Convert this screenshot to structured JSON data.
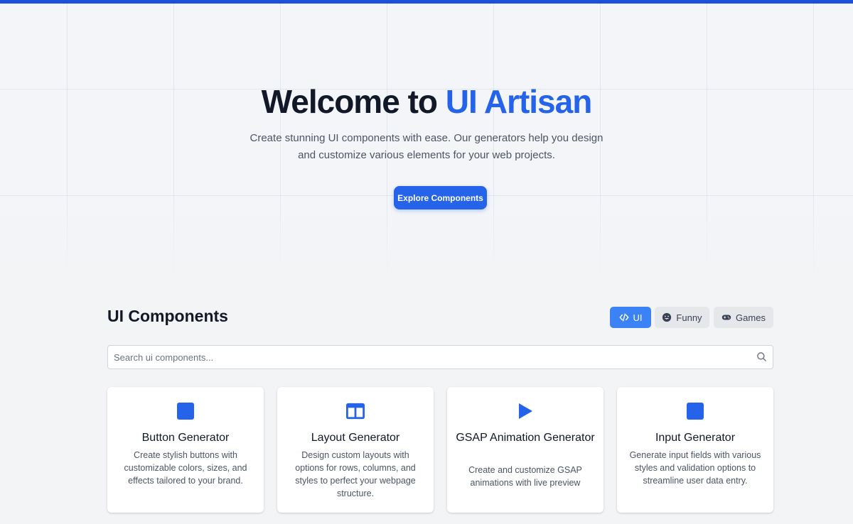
{
  "hero": {
    "title_main": "Welcome to ",
    "title_accent": "UI Artisan",
    "subtitle": "Create stunning UI components with ease. Our generators help you design and customize various elements for your web projects.",
    "cta_label": "Explore Components"
  },
  "section": {
    "title": "UI Components",
    "tabs": [
      {
        "label": "UI",
        "icon": "code-icon",
        "active": true
      },
      {
        "label": "Funny",
        "icon": "smile-icon",
        "active": false
      },
      {
        "label": "Games",
        "icon": "gamepad-icon",
        "active": false
      }
    ],
    "search_placeholder": "Search ui components..."
  },
  "cards": [
    {
      "title": "Button Generator",
      "description": "Create stylish buttons with customizable colors, sizes, and effects tailored to your brand.",
      "icon": "square-icon"
    },
    {
      "title": "Layout Generator",
      "description": "Design custom layouts with options for rows, columns, and styles to perfect your webpage structure.",
      "icon": "columns-icon"
    },
    {
      "title": "GSAP Animation Generator",
      "description": "Create and customize GSAP animations with live preview",
      "icon": "play-icon"
    },
    {
      "title": "Input Generator",
      "description": "Generate input fields with various styles and validation options to streamline user data entry.",
      "icon": "square-icon"
    }
  ],
  "colors": {
    "accent": "#2563eb",
    "top_bar": "#1e4fd8",
    "active_tab": "#3b82f6"
  }
}
